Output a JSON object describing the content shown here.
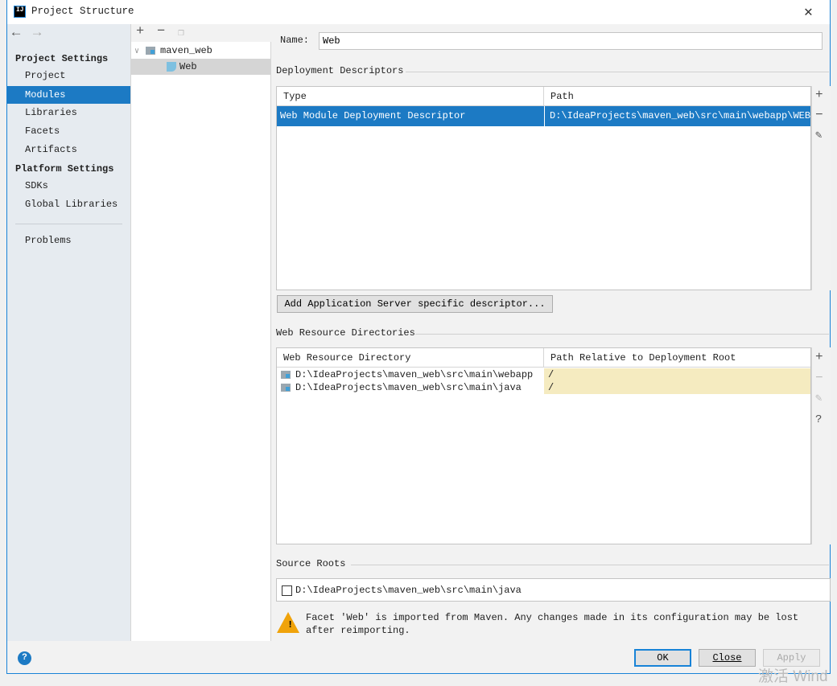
{
  "window": {
    "title": "Project Structure",
    "app_icon_text": "IJ"
  },
  "sidebar": {
    "project_settings": "Project Settings",
    "project_items": [
      {
        "label": "Project"
      },
      {
        "label": "Modules",
        "selected": true
      },
      {
        "label": "Libraries"
      },
      {
        "label": "Facets"
      },
      {
        "label": "Artifacts"
      }
    ],
    "platform_settings": "Platform Settings",
    "platform_items": [
      {
        "label": "SDKs"
      },
      {
        "label": "Global Libraries"
      }
    ],
    "problems": "Problems"
  },
  "tree": {
    "items": [
      {
        "label": "maven_web",
        "expanded": true
      },
      {
        "label": "Web",
        "selected": true
      }
    ]
  },
  "main": {
    "name_label": "Name:",
    "name_value": "Web",
    "deployment_descriptors": {
      "title": "Deployment Descriptors",
      "columns": [
        "Type",
        "Path"
      ],
      "rows": [
        {
          "type": "Web Module Deployment Descriptor",
          "path": "D:\\IdeaProjects\\maven_web\\src\\main\\webapp\\WEB-INF\\web.xml"
        }
      ]
    },
    "add_server_descriptor": "Add Application Server specific descriptor...",
    "web_resource_directories": {
      "title": "Web Resource Directories",
      "columns": [
        "Web Resource Directory",
        "Path Relative to Deployment Root"
      ],
      "rows": [
        {
          "dir": "D:\\IdeaProjects\\maven_web\\src\\main\\webapp",
          "path": "/"
        },
        {
          "dir": "D:\\IdeaProjects\\maven_web\\src\\main\\java",
          "path": "/"
        }
      ]
    },
    "source_roots": {
      "title": "Source Roots",
      "items": [
        {
          "label": "D:\\IdeaProjects\\maven_web\\src\\main\\java",
          "checked": false
        }
      ]
    },
    "warning": "Facet 'Web' is imported from Maven. Any changes made in its configuration may be lost after reimporting."
  },
  "buttons": {
    "ok": "OK",
    "close": "Close",
    "apply": "Apply",
    "help": "?"
  },
  "colors": {
    "selection": "#1c7ac4",
    "warning_cell": "#f5ebc0",
    "sidebar_bg": "#e6ebf0"
  },
  "watermark": "激活 Wind"
}
